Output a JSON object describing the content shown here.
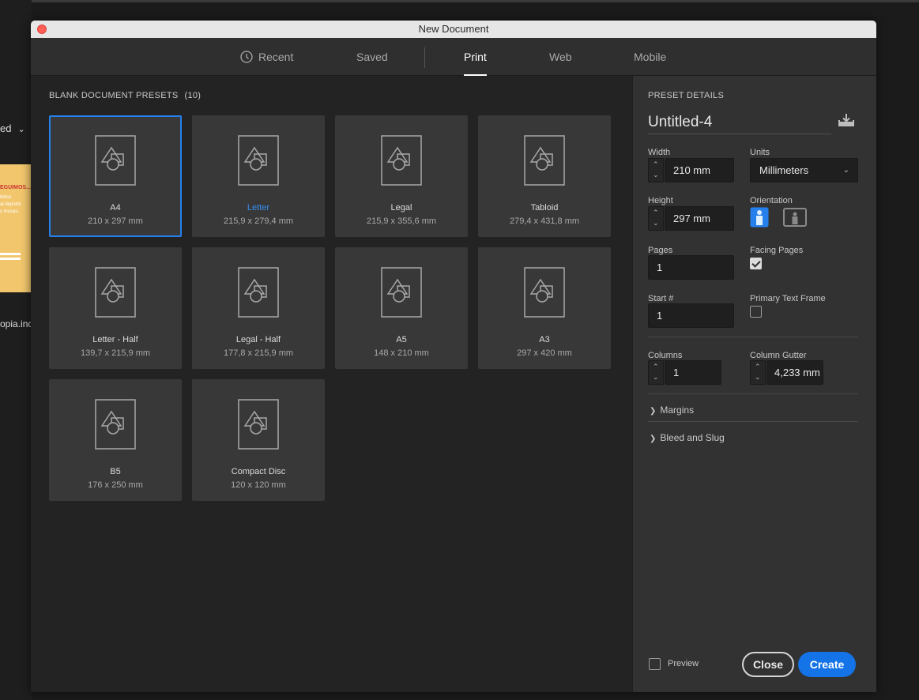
{
  "background": {
    "dropdown_text": "ed",
    "thumb_heading": "EGUIMOS...",
    "thumb_lines": [
      "tético",
      "al deporte",
      "s musas."
    ],
    "filename": "opia.inc"
  },
  "dialog": {
    "title": "New Document",
    "tabs": [
      {
        "label": "Recent",
        "icon": "clock-icon"
      },
      {
        "label": "Saved"
      },
      {
        "label": "Print"
      },
      {
        "label": "Web"
      },
      {
        "label": "Mobile"
      }
    ],
    "active_tab": "Print"
  },
  "presets": {
    "title": "BLANK DOCUMENT PRESETS",
    "count": "(10)",
    "items": [
      {
        "name": "A4",
        "dims": "210 x 297 mm"
      },
      {
        "name": "Letter",
        "dims": "215,9 x 279,4 mm"
      },
      {
        "name": "Legal",
        "dims": "215,9 x 355,6 mm"
      },
      {
        "name": "Tabloid",
        "dims": "279,4 x 431,8 mm"
      },
      {
        "name": "Letter - Half",
        "dims": "139,7 x 215,9 mm"
      },
      {
        "name": "Legal - Half",
        "dims": "177,8 x 215,9 mm"
      },
      {
        "name": "A5",
        "dims": "148 x 210 mm"
      },
      {
        "name": "A3",
        "dims": "297 x 420 mm"
      },
      {
        "name": "B5",
        "dims": "176 x 250 mm"
      },
      {
        "name": "Compact Disc",
        "dims": "120 x 120 mm"
      }
    ],
    "selected": "A4"
  },
  "details": {
    "title": "PRESET DETAILS",
    "doc_name": "Untitled-4",
    "width_label": "Width",
    "width_value": "210 mm",
    "units_label": "Units",
    "units_value": "Millimeters",
    "height_label": "Height",
    "height_value": "297 mm",
    "orientation_label": "Orientation",
    "orientation_selected": "portrait",
    "pages_label": "Pages",
    "pages_value": "1",
    "facing_pages_label": "Facing Pages",
    "facing_pages_checked": true,
    "start_label": "Start #",
    "start_value": "1",
    "primary_text_frame_label": "Primary Text Frame",
    "primary_text_frame_checked": false,
    "columns_label": "Columns",
    "columns_value": "1",
    "gutter_label": "Column Gutter",
    "gutter_value": "4,233 mm",
    "margins_label": "Margins",
    "bleed_label": "Bleed and Slug",
    "preview_label": "Preview",
    "preview_checked": false,
    "close_label": "Close",
    "create_label": "Create"
  },
  "colors": {
    "accent": "#2680eb",
    "create_button": "#1473e6",
    "close_dot": "#ff5f57"
  }
}
